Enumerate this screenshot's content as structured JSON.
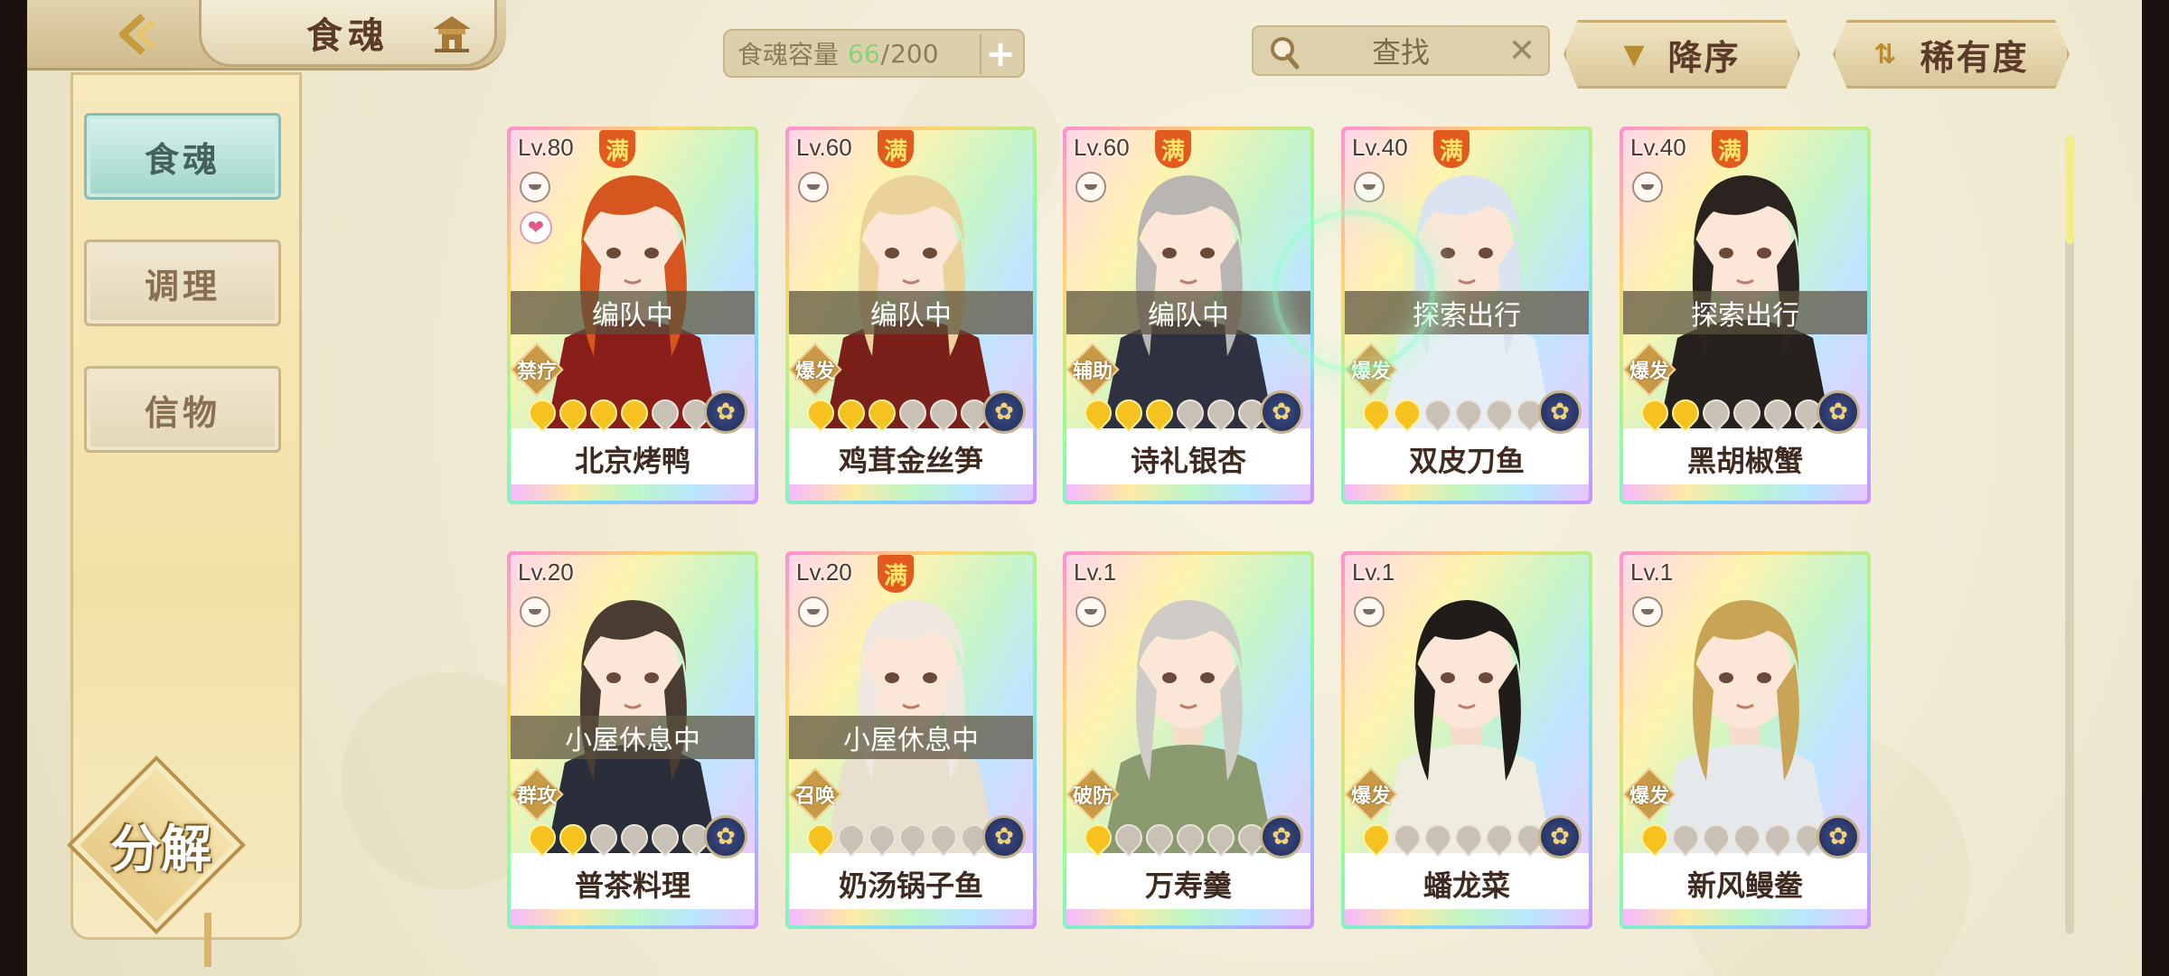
{
  "header": {
    "title": "食魂",
    "capacity_label": "食魂容量",
    "capacity_current": "66",
    "capacity_sep": "/",
    "capacity_max": "200",
    "plus": "+",
    "search_text": "查找",
    "search_clear": "✕",
    "sort_label": "降序",
    "rarity_label": "稀有度"
  },
  "sidebar": {
    "tabs": [
      {
        "label": "食魂",
        "active": true
      },
      {
        "label": "调理",
        "active": false
      },
      {
        "label": "信物",
        "active": false
      }
    ],
    "decompose_label": "分解"
  },
  "cards": [
    {
      "level": "Lv.80",
      "full": "满",
      "status": "编队中",
      "role": "禁疗",
      "stars_on": 4,
      "name": "北京烤鸭",
      "heart": true,
      "hair": "#d5571f",
      "outfit": "#8a1e1a"
    },
    {
      "level": "Lv.60",
      "full": "满",
      "status": "编队中",
      "role": "爆发",
      "stars_on": 3,
      "name": "鸡茸金丝笋",
      "heart": false,
      "hair": "#ead29a",
      "outfit": "#7a1f1a"
    },
    {
      "level": "Lv.60",
      "full": "满",
      "status": "编队中",
      "role": "辅助",
      "stars_on": 3,
      "name": "诗礼银杏",
      "heart": false,
      "hair": "#b9b5b2",
      "outfit": "#2f3040"
    },
    {
      "level": "Lv.40",
      "full": "满",
      "status": "探索出行",
      "role": "爆发",
      "stars_on": 2,
      "name": "双皮刀鱼",
      "heart": false,
      "hair": "#dbe3f0",
      "outfit": "#e8eef5"
    },
    {
      "level": "Lv.40",
      "full": "满",
      "status": "探索出行",
      "role": "爆发",
      "stars_on": 2,
      "name": "黑胡椒蟹",
      "heart": false,
      "hair": "#2b2320",
      "outfit": "#26201e"
    },
    {
      "level": "Lv.20",
      "full": "",
      "status": "小屋休息中",
      "role": "群攻",
      "stars_on": 2,
      "name": "普茶料理",
      "heart": false,
      "hair": "#4a3b33",
      "outfit": "#2a2e3a"
    },
    {
      "level": "Lv.20",
      "full": "满",
      "status": "小屋休息中",
      "role": "召唤",
      "stars_on": 1,
      "name": "奶汤锅子鱼",
      "heart": false,
      "hair": "#efe8e0",
      "outfit": "#e9dfcf"
    },
    {
      "level": "Lv.1",
      "full": "",
      "status": "",
      "role": "破防",
      "stars_on": 1,
      "name": "万寿羹",
      "heart": false,
      "hair": "#cfcbc7",
      "outfit": "#8c9a70"
    },
    {
      "level": "Lv.1",
      "full": "",
      "status": "",
      "role": "爆发",
      "stars_on": 1,
      "name": "蟠龙菜",
      "heart": false,
      "hair": "#1f1c1a",
      "outfit": "#efece0"
    },
    {
      "level": "Lv.1",
      "full": "",
      "status": "",
      "role": "爆发",
      "stars_on": 1,
      "name": "新风鳗鲞",
      "heart": false,
      "hair": "#caa456",
      "outfit": "#e6e9ec"
    }
  ],
  "colors": {
    "capacity_current": "#8bd17a",
    "active_tab": "#9fd6ca",
    "star_on": "#f5c21f"
  },
  "scroll_position": 0
}
